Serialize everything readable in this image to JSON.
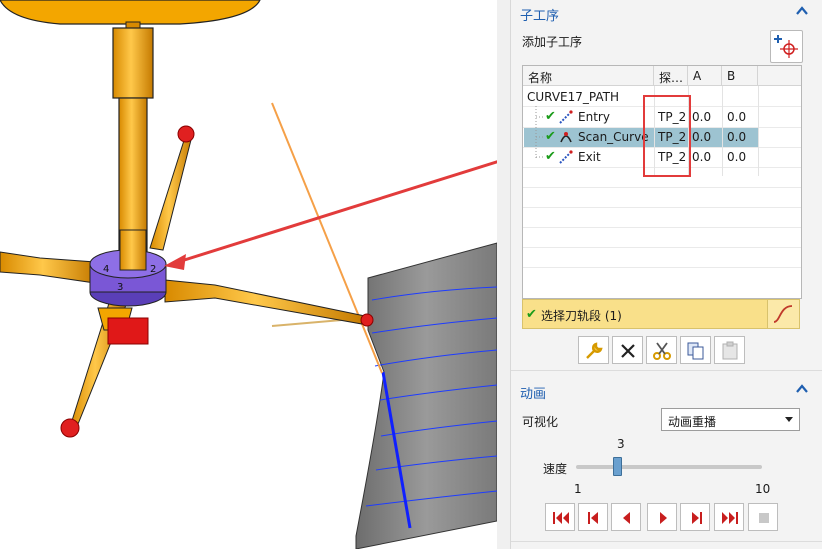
{
  "subops": {
    "title": "子工序",
    "add_label": "添加子工序",
    "columns": [
      "名称",
      "探…",
      "A",
      "B"
    ],
    "parent": "CURVE17_PATH",
    "rows": [
      {
        "name": "Entry",
        "probe": "TP_2",
        "a": "0.0",
        "b": "0.0",
        "selected": false
      },
      {
        "name": "Scan_Curve",
        "probe": "TP_2",
        "a": "0.0",
        "b": "0.0",
        "selected": true
      },
      {
        "name": "Exit",
        "probe": "TP_2",
        "a": "0.0",
        "b": "0.0",
        "selected": false
      }
    ],
    "select_label": "选择刀轨段 (1)"
  },
  "animation": {
    "title": "动画",
    "vis_label": "可视化",
    "vis_value": "动画重播",
    "speed_label": "速度",
    "speed_value": "3",
    "speed_min": "1",
    "speed_max": "10"
  },
  "colors": {
    "accent": "#1f5fb0",
    "highlight_box": "#e23b3b",
    "selected_row": "#9dc3d1",
    "select_bar": "#f9e08a",
    "probe_orange": "#f5a300",
    "probe_purple": "#7a57d6"
  },
  "icons": {
    "caret": "chevron-up-icon",
    "add": "add-subop-icon",
    "tick": "check-icon",
    "tools": [
      "wrench-icon",
      "delete-icon",
      "cut-icon",
      "copy-icon",
      "paste-icon"
    ],
    "playback": [
      "first-icon",
      "step-back-icon",
      "play-back-icon",
      "play-icon",
      "step-forward-icon",
      "last-icon",
      "stop-icon"
    ]
  }
}
